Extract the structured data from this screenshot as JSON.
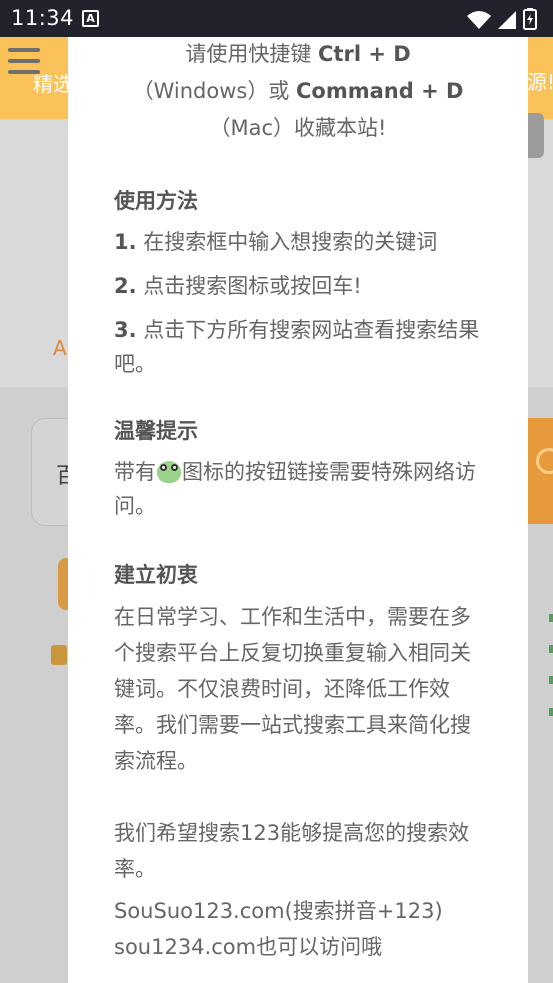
{
  "status_bar": {
    "time": "11:34",
    "notification_badge": "A",
    "icons": [
      "wifi-icon",
      "signal-icon",
      "battery-icon"
    ]
  },
  "background_page": {
    "header_left_text": "精选",
    "header_right_text": "源!",
    "truncated_label": "A",
    "search_box_char": "百",
    "header_color": "#fbc25a"
  },
  "modal": {
    "intro": {
      "line1_prefix": "请使用快捷键 ",
      "line1_key": "Ctrl + D",
      "line2_prefix": "（Windows）或 ",
      "line2_key": "Command + D",
      "line3": "（Mac）收藏本站!"
    },
    "usage": {
      "title": "使用方法",
      "steps": [
        {
          "num": "1.",
          "text": " 在搜索框中输入想搜索的关键词"
        },
        {
          "num": "2.",
          "text": " 点击搜索图标或按回车!"
        },
        {
          "num": "3.",
          "text": " 点击下方所有搜索网站查看搜索结果吧。"
        }
      ]
    },
    "tips": {
      "title": "温馨提示",
      "text_before_icon": "带有",
      "icon": "frog-icon",
      "text_after_icon": "图标的按钮链接需要特殊网络访问。"
    },
    "origin": {
      "title": "建立初衷",
      "paragraph1": "在日常学习、工作和生活中，需要在多个搜索平台上反复切换重复输入相同关键词。不仅浪费时间，还降低工作效率。我们需要一站式搜索工具来简化搜索流程。",
      "paragraph2": "我们希望搜索123能够提高您的搜索效率。",
      "paragraph3": "SouSuo123.com(搜索拼音+123)",
      "paragraph4": "sou1234.com也可以访问哦"
    }
  }
}
